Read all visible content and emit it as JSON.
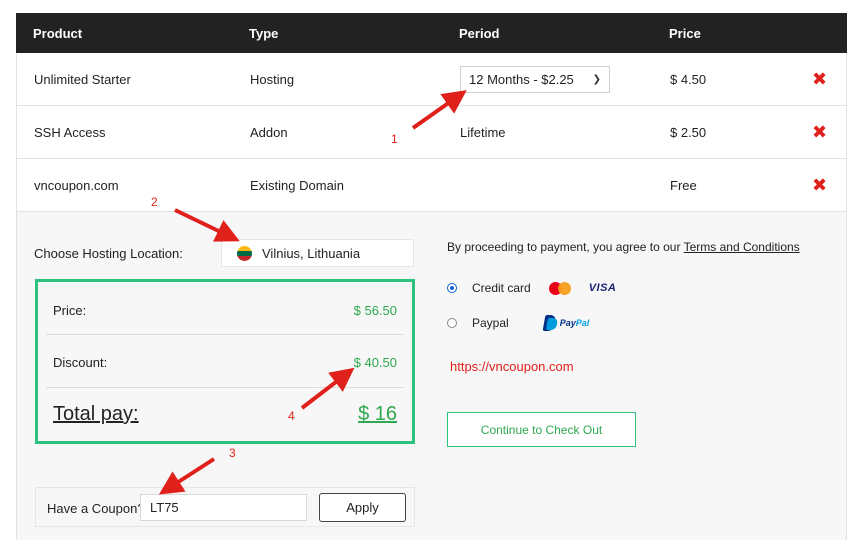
{
  "table": {
    "headers": [
      "Product",
      "Type",
      "Period",
      "Price"
    ],
    "rows": [
      {
        "product": "Unlimited Starter",
        "type": "Hosting",
        "period": "12 Months - $2.25",
        "price": "$ 4.50"
      },
      {
        "product": "SSH Access",
        "type": "Addon",
        "period": "Lifetime",
        "price": "$ 2.50"
      },
      {
        "product": "vncoupon.com",
        "type": "Existing Domain",
        "period": "",
        "price": "Free"
      }
    ],
    "remove_icon": "✖"
  },
  "location": {
    "label": "Choose Hosting Location:",
    "value": "Vilnius, Lithuania",
    "flag_icon": "lithuania-flag-icon"
  },
  "summary": {
    "price_label": "Price:",
    "price_value": "$ 56.50",
    "discount_label": "Discount:",
    "discount_value": "$ 40.50",
    "total_label": "Total pay:",
    "total_value": "$ 16"
  },
  "coupon": {
    "label": "Have a Coupon?",
    "value": "LT75",
    "apply_label": "Apply"
  },
  "payment": {
    "terms_prefix": "By proceeding to payment, you agree to our ",
    "terms_link": "Terms and Conditions",
    "credit_label": "Credit card",
    "visa_label": "VISA",
    "paypal_label": "Paypal",
    "paypal_logo_pay": "Pay",
    "paypal_logo_pal": "Pal",
    "selected": "credit-card"
  },
  "watermark_url": "https://vncoupon.com",
  "checkout_label": "Continue to Check Out",
  "annotations": [
    "1",
    "2",
    "3",
    "4"
  ],
  "colors": {
    "accent_green": "#2ec27e",
    "price_green": "#2fa84f",
    "annotation_red": "#e0201b",
    "header_dark": "#222222"
  }
}
